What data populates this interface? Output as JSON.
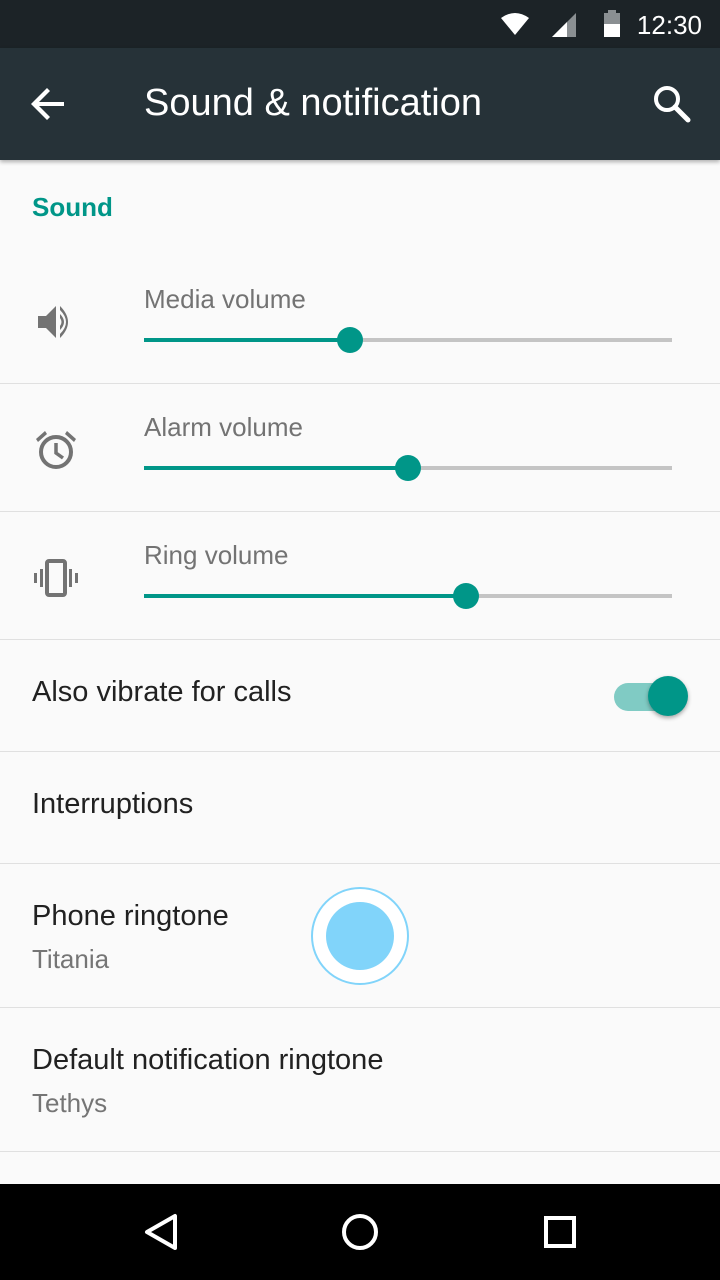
{
  "status_bar": {
    "time": "12:30",
    "icons": [
      "wifi-icon",
      "cell-signal-icon",
      "battery-icon"
    ]
  },
  "app_bar": {
    "title": "Sound & notification",
    "back_icon": "arrow-back-icon",
    "search_icon": "search-icon",
    "color": "#263238"
  },
  "section": {
    "header": "Sound"
  },
  "volumes": [
    {
      "label": "Media volume",
      "icon": "speaker-icon",
      "level": 0.39
    },
    {
      "label": "Alarm volume",
      "icon": "alarm-clock-icon",
      "level": 0.5
    },
    {
      "label": "Ring volume",
      "icon": "vibrate-icon",
      "level": 0.61
    }
  ],
  "settings": {
    "vibrate": {
      "label": "Also vibrate for calls",
      "enabled": true
    },
    "interruptions": {
      "label": "Interruptions"
    },
    "phone_ringtone": {
      "label": "Phone ringtone",
      "value": "Titania"
    },
    "notification_ringtone": {
      "label": "Default notification ringtone",
      "value": "Tethys"
    }
  },
  "nav_bar": {
    "icons": [
      "back-triangle-icon",
      "home-circle-icon",
      "recents-square-icon"
    ]
  },
  "colors": {
    "accent": "#009688",
    "accent_light": "#80cbc4",
    "touch_indicator": "#81d4fa"
  }
}
